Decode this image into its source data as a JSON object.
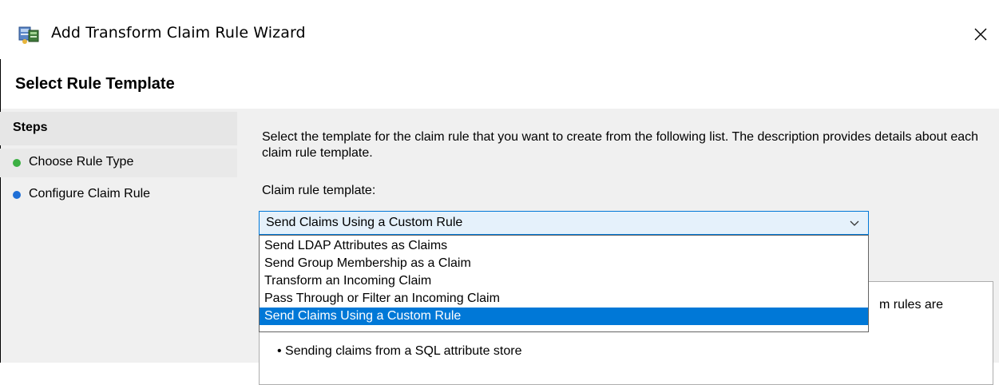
{
  "window": {
    "title": "Add Transform Claim Rule Wizard",
    "close_glyph": "✕",
    "app_icon": "adfs-wizard-icon"
  },
  "header": {
    "title": "Select Rule Template"
  },
  "steps": {
    "title": "Steps",
    "items": [
      {
        "label": "Choose Rule Type",
        "status_color": "#3cb043",
        "icon": "green-dot-icon"
      },
      {
        "label": "Configure Claim Rule",
        "status_color": "#1f6fd6",
        "icon": "blue-dot-icon"
      }
    ]
  },
  "main": {
    "description": "Select the template for the claim rule that you want to create from the following list. The description provides details about each claim rule template.",
    "template_label": "Claim rule template:",
    "select": {
      "value": "Send Claims Using a Custom Rule"
    },
    "options": [
      "Send LDAP Attributes as Claims",
      "Send Group Membership as a Claim",
      "Transform an Incoming Claim",
      "Pass Through or Filter an Incoming Claim",
      "Send Claims Using a Custom Rule"
    ],
    "selected_option": "Send Claims Using a Custom Rule",
    "description_box": {
      "visible_tail": "m rules are",
      "bullet": "• Sending claims from a SQL attribute store"
    }
  },
  "colors": {
    "accent": "#0078d7",
    "select_bg": "#e5f1fb",
    "window_bg": "#f0f0f0"
  }
}
